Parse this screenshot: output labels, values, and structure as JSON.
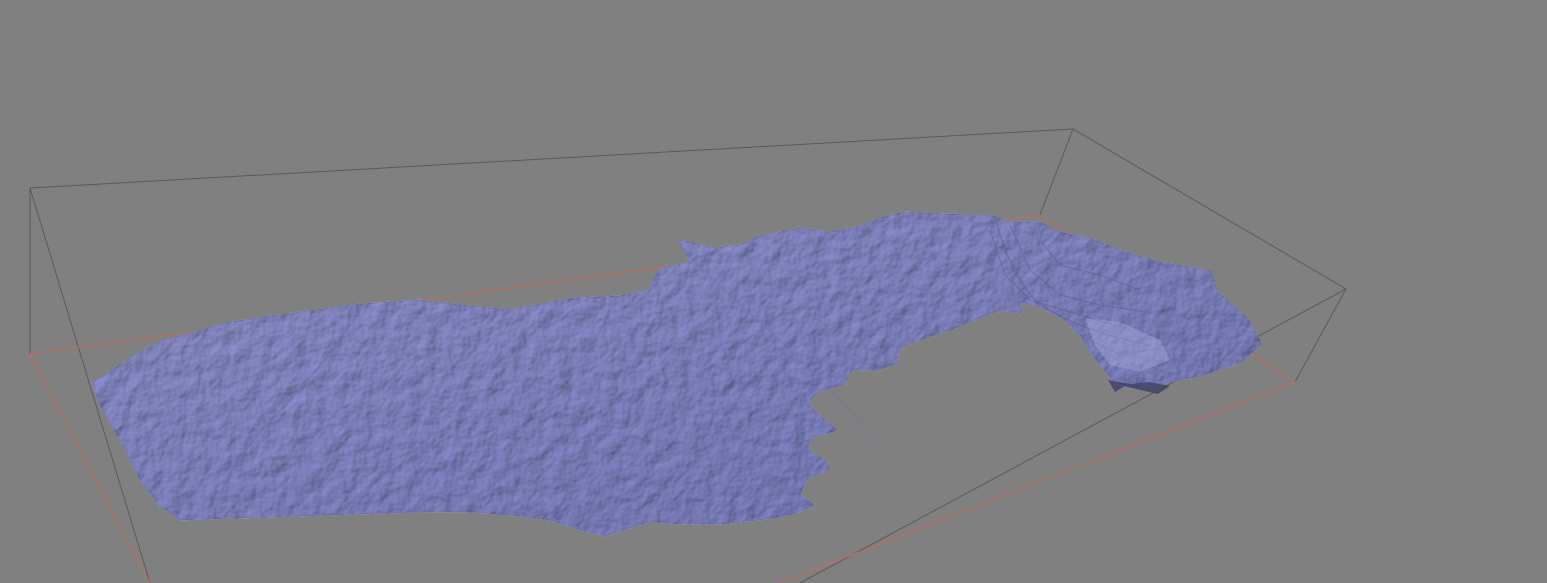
{
  "viewport": {
    "background_color": "#808080",
    "mesh_color": "#8c8fd2",
    "mesh_shadow_color": "#5f6198",
    "mesh_highlight_color": "#b3b6e8",
    "bbox_edge_color": "#5a5a5a",
    "ground_edge_color": "#c46a5f",
    "icons": [
      "terrain-mesh",
      "bounding-box"
    ]
  }
}
